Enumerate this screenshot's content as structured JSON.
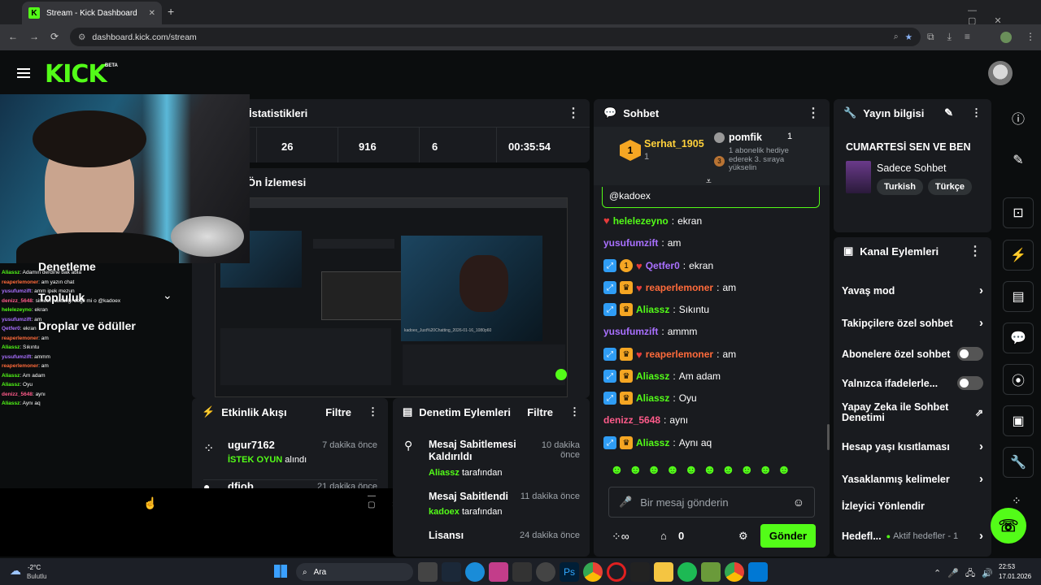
{
  "browser": {
    "tab_title": "Stream - Kick Dashboard",
    "url": "dashboard.kick.com/stream"
  },
  "header": {
    "logo": "KICK",
    "beta": "BETA"
  },
  "stats": {
    "title": "İstatistikleri",
    "values": [
      "26",
      "916",
      "6",
      "00:35:54"
    ]
  },
  "preview": {
    "title": "Ön İzlemesi",
    "filename": "kadoex_Just%20Chatting_2026-01-16_1080p60"
  },
  "left_menu": {
    "items": [
      "Denetleme",
      "Topluluk",
      "Droplar ve ödüller"
    ]
  },
  "overlay_chat": [
    {
      "user": "Aliassz",
      "text": "Adamın derdine bak abla"
    },
    {
      "user": "reaperlemoner",
      "text": "am yazın chat"
    },
    {
      "user": "yusufumzift",
      "text": "amm ipek mezun"
    },
    {
      "user": "denizz_5648",
      "text": "simetri hastalığı değil mi o @kadoex"
    },
    {
      "user": "helelezeyno",
      "text": "ekran"
    },
    {
      "user": "yusufumzift",
      "text": "am"
    },
    {
      "user": "Qetfer0",
      "text": "ekran"
    },
    {
      "user": "reaperlemoner",
      "text": "am"
    },
    {
      "user": "Aliassz",
      "text": "Sıkıntu"
    },
    {
      "user": "yusufumzift",
      "text": "ammm"
    },
    {
      "user": "reaperlemoner",
      "text": "am"
    },
    {
      "user": "Aliassz",
      "text": "Am adam"
    },
    {
      "user": "Aliassz",
      "text": "Oyu"
    },
    {
      "user": "denizz_5648",
      "text": "aynı"
    },
    {
      "user": "Aliassz",
      "text": "Aynı aq"
    }
  ],
  "activity": {
    "title": "Etkinlik Akışı",
    "filter": "Filtre",
    "items": [
      {
        "user": "ugur7162",
        "time": "7 dakika önce",
        "action": "İSTEK OYUN",
        "suffix": "alındı"
      },
      {
        "user": "dfiob",
        "time": "21 dakika önce"
      }
    ]
  },
  "moderation": {
    "title": "Denetim Eylemleri",
    "filter": "Filtre",
    "items": [
      {
        "title": "Mesaj Sabitlemesi Kaldırıldı",
        "time": "10 dakika önce",
        "by": "Aliassz",
        "by_suffix": "tarafından"
      },
      {
        "title": "Mesaj Sabitlendi",
        "time": "11 dakika önce",
        "by": "kadoex",
        "by_suffix": "tarafından"
      },
      {
        "title": "Lisansı",
        "time": "24 dakika önce"
      }
    ]
  },
  "chat": {
    "title": "Sohbet",
    "top1": {
      "rank": "1",
      "user": "Serhat_1905",
      "count": "1"
    },
    "top2": {
      "user": "pomfik",
      "count": "1",
      "desc": "1 abonelik hediye ederek 3. sıraya yükselin",
      "rank3": "3"
    },
    "mention": "@kadoex",
    "messages": [
      {
        "user": "helelezeyno",
        "text": "ekran",
        "color": "u-green"
      },
      {
        "user": "yusufumzift",
        "text": "am",
        "color": "u-purple"
      },
      {
        "user": "Qetfer0",
        "text": "ekran",
        "color": "u-purple"
      },
      {
        "user": "reaperlemoner",
        "text": "am",
        "color": "u-orange"
      },
      {
        "user": "Aliassz",
        "text": "Sıkıntu",
        "color": "u-green"
      },
      {
        "user": "yusufumzift",
        "text": "ammm",
        "color": "u-purple"
      },
      {
        "user": "reaperlemoner",
        "text": "am",
        "color": "u-orange"
      },
      {
        "user": "Aliassz",
        "text": "Am adam",
        "color": "u-green"
      },
      {
        "user": "Aliassz",
        "text": "Oyu",
        "color": "u-green"
      },
      {
        "user": "denizz_5648",
        "text": "aynı",
        "color": "u-pink"
      },
      {
        "user": "Aliassz",
        "text": "Aynı aq",
        "color": "u-green"
      }
    ],
    "placeholder": "Bir mesaj gönderin",
    "count": "0",
    "send": "Gönder"
  },
  "stream_info": {
    "title": "Yayın bilgisi",
    "stream_title": "CUMARTESİ SEN VE BEN",
    "category": "Sadece Sohbet",
    "tags": [
      "Turkish",
      "Türkçe"
    ]
  },
  "channel_actions": {
    "title": "Kanal Eylemleri",
    "items": [
      "Yavaş mod",
      "Takipçilere özel sohbet",
      "Abonelere özel sohbet",
      "Yalnızca ifadelerle...",
      "Yapay Zeka ile Sohbet Denetimi",
      "Hesap yaşı kısıtlaması",
      "Yasaklanmış kelimeler",
      "İzleyici Yönlendir",
      "Hedefl..."
    ],
    "goal_status": "Aktif hedefler - 1"
  },
  "taskbar": {
    "weather_temp": "-2°C",
    "weather_desc": "Bulutlu",
    "search": "Ara",
    "time": "22:53",
    "date": "17.01.2026"
  },
  "colors": {
    "accent": "#53fc18",
    "panel": "#191b1f",
    "bg": "#0b0d0e"
  }
}
